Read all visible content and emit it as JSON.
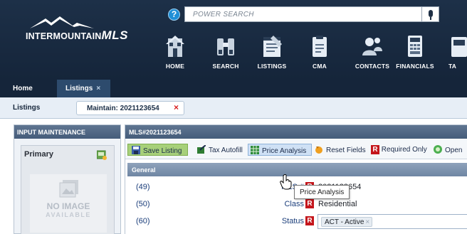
{
  "header": {
    "logo_text_regular": "INTERMOUNTAIN",
    "logo_text_bold": "MLS",
    "help_label": "?",
    "search": {
      "placeholder": "POWER SEARCH"
    },
    "nav": [
      {
        "label": "HOME",
        "icon": "home-icon"
      },
      {
        "label": "SEARCH",
        "icon": "binoculars-icon"
      },
      {
        "label": "LISTINGS",
        "icon": "listings-icon"
      },
      {
        "label": "CMA",
        "icon": "cma-icon"
      },
      {
        "label": "CONTACTS",
        "icon": "contacts-icon"
      },
      {
        "label": "FINANCIALS",
        "icon": "calculator-icon"
      },
      {
        "label": "TA",
        "icon": "tax-icon"
      }
    ]
  },
  "tabs": {
    "home": "Home",
    "listings": "Listings",
    "close_glyph": "×"
  },
  "subbar": {
    "title": "Listings",
    "active_tab": "Maintain: 2021123654",
    "close_glyph": "×"
  },
  "left_panel": {
    "title": "INPUT MAINTENANCE",
    "primary_label": "Primary",
    "no_image": "NO IMAGE",
    "available": "AVAILABLE"
  },
  "main_panel": {
    "title": "MLS#2021123654",
    "toolbar": {
      "save": "Save Listing",
      "autofill": "Tax Autofill",
      "price": "Price Analysis",
      "reset": "Reset Fields",
      "required_badge": "R",
      "required": "Required Only",
      "open": "Open"
    },
    "section": "General",
    "fields": [
      {
        "num": "(49)",
        "label": "MLS #",
        "value": "2021123654"
      },
      {
        "num": "(50)",
        "label": "Class",
        "value": "Residential"
      },
      {
        "num": "(60)",
        "label": "Status",
        "value": "ACT - Active"
      }
    ],
    "required_badge": "R",
    "chip_remove": "×"
  },
  "tooltip": "Price Analysis",
  "colors": {
    "header_bg": "#1d3048",
    "tab_active": "#2d4b6d",
    "save_green": "#a7d07a",
    "required_red": "#c4161c",
    "field_blue": "#1a3d7a"
  }
}
